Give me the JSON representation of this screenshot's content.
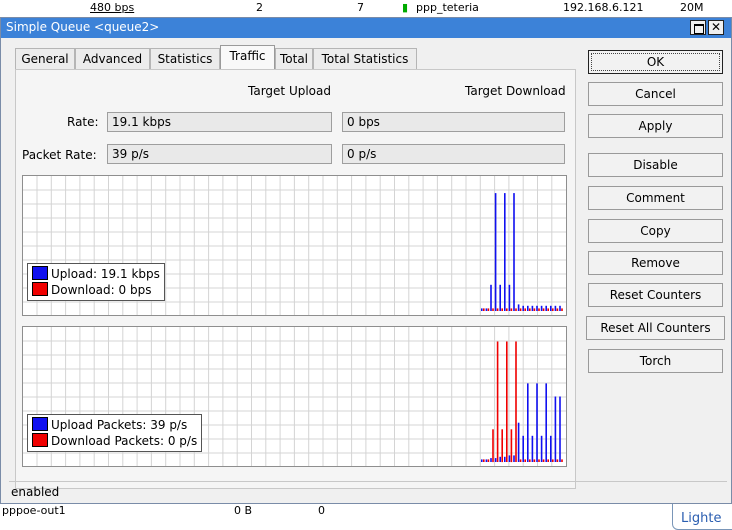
{
  "background": {
    "top_row": [
      "480 bps",
      "2",
      "7",
      "ppp_teteria",
      "192.168.6.121",
      "20M"
    ],
    "bottom_row": [
      "pppoe-out1",
      "0 B",
      "0"
    ],
    "popup_text": "Lighte"
  },
  "window": {
    "title": "Simple Queue <queue2>",
    "close_glyph": "✕"
  },
  "tabs": [
    {
      "label": "General"
    },
    {
      "label": "Advanced"
    },
    {
      "label": "Statistics"
    },
    {
      "label": "Traffic"
    },
    {
      "label": "Total"
    },
    {
      "label": "Total Statistics"
    }
  ],
  "active_tab": "Traffic",
  "traffic": {
    "col_upload": "Target Upload",
    "col_download": "Target Download",
    "rate_label": "Rate:",
    "rate_upload": "19.1 kbps",
    "rate_download": "0 bps",
    "packet_label": "Packet Rate:",
    "packet_upload": "39 p/s",
    "packet_download": "0 p/s"
  },
  "graph_rate": {
    "legend_upload": "Upload:  19.1 kbps",
    "legend_download": "Download:  0 bps",
    "upload_color": "#1010f0",
    "download_color": "#f00000"
  },
  "graph_packets": {
    "legend_upload": "Upload Packets:  39 p/s",
    "legend_download": "Download Packets:  0 p/s",
    "upload_color": "#1010f0",
    "download_color": "#f00000"
  },
  "buttons": {
    "ok": "OK",
    "cancel": "Cancel",
    "apply": "Apply",
    "disable": "Disable",
    "comment": "Comment",
    "copy": "Copy",
    "remove": "Remove",
    "reset_counters": "Reset Counters",
    "reset_all_counters": "Reset All Counters",
    "torch": "Torch"
  },
  "status": "enabled",
  "chart_data": [
    {
      "type": "bar",
      "series": [
        {
          "values": [
            0.02,
            0.02,
            0.2,
            0.9,
            0.2,
            0.9,
            0.2,
            0.9,
            0.05,
            0.04,
            0.04,
            0.04,
            0.04,
            0.04,
            0.04,
            0.04,
            0.04,
            0.04
          ]
        },
        {
          "values": [
            0.02,
            0.02,
            0.02,
            0.02,
            0.02,
            0.02,
            0.02,
            0.02,
            0.02,
            0.02,
            0.02,
            0.02,
            0.02,
            0.02,
            0.02,
            0.02,
            0.02,
            0.02
          ]
        }
      ],
      "grid": true
    },
    {
      "type": "bar",
      "series": [
        {
          "values": [
            0.02,
            0.02,
            0.03,
            0.03,
            0.04,
            0.04,
            0.05,
            0.05,
            0.3,
            0.2,
            0.6,
            0.2,
            0.6,
            0.2,
            0.6,
            0.2,
            0.5,
            0.5
          ]
        },
        {
          "values": [
            0.02,
            0.02,
            0.25,
            0.92,
            0.25,
            0.92,
            0.25,
            0.92,
            0.02,
            0.02,
            0.02,
            0.02,
            0.02,
            0.02,
            0.02,
            0.02,
            0.02,
            0.02
          ]
        }
      ],
      "grid": true
    }
  ]
}
